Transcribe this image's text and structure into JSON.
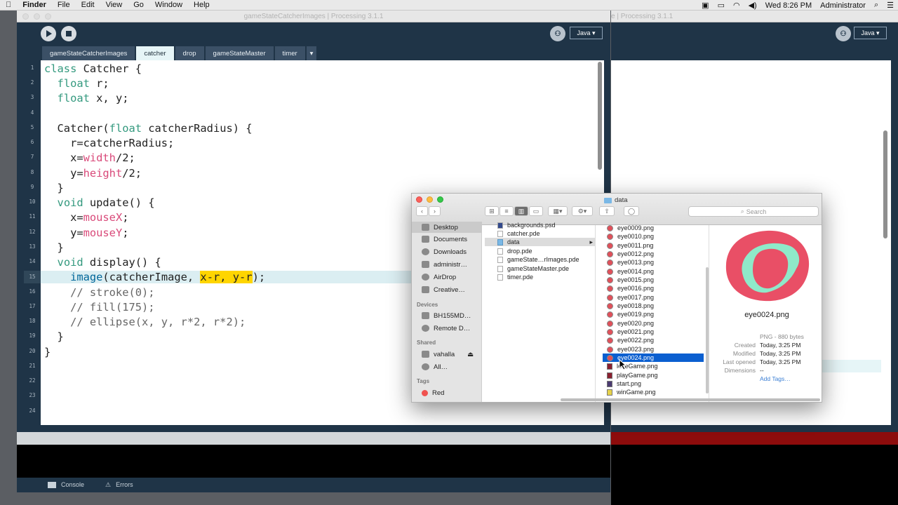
{
  "menubar": {
    "app": "Finder",
    "menus": [
      "File",
      "Edit",
      "View",
      "Go",
      "Window",
      "Help"
    ],
    "clock": "Wed 8:26 PM",
    "user": "Administrator"
  },
  "left_window": {
    "title": "gameStateCatcherImages | Processing 3.1.1",
    "mode": "Java ▾",
    "tabs": [
      "gameStateCatcherImages",
      "catcher",
      "drop",
      "gameStateMaster",
      "timer",
      "▾"
    ],
    "active_tab": "catcher",
    "footer": {
      "console": "Console",
      "errors": "Errors"
    },
    "line_numbers": [
      "1",
      "2",
      "3",
      "4",
      "5",
      "6",
      "7",
      "8",
      "9",
      "10",
      "11",
      "12",
      "13",
      "14",
      "15",
      "16",
      "17",
      "18",
      "19",
      "20",
      "21",
      "22",
      "23",
      "24"
    ]
  },
  "code": {
    "l1": [
      "class",
      " Catcher {"
    ],
    "l2": [
      "  ",
      "float",
      " r;"
    ],
    "l3": [
      "  ",
      "float",
      " x, y;"
    ],
    "l5": [
      "  Catcher(",
      "float",
      " catcherRadius) {"
    ],
    "l6": "    r=catcherRadius;",
    "l7": [
      "    x=",
      "width",
      "/2;"
    ],
    "l8": [
      "    y=",
      "height",
      "/2;"
    ],
    "l9": "  }",
    "l10": [
      "  ",
      "void",
      " update() {"
    ],
    "l11": [
      "    x=",
      "mouseX",
      ";"
    ],
    "l12": [
      "    y=",
      "mouseY",
      ";"
    ],
    "l13": "  }",
    "l14": [
      "  ",
      "void",
      " display() {"
    ],
    "l15": [
      "    ",
      "image",
      "(catcherImage, ",
      "x-r, y-r",
      ");"
    ],
    "l16": "    // stroke(0);",
    "l17": "    // fill(175);",
    "l18": "    // ellipse(x, y, r*2, r*2);",
    "l19": "  }",
    "l20": "}"
  },
  "right_window": {
    "title": "e | Processing 3.1.1",
    "mode": "Java ▾"
  },
  "finder": {
    "title": "data",
    "search_placeholder": "Search",
    "sidebar": {
      "favorites": [
        "Desktop",
        "Documents",
        "Downloads",
        "administr…",
        "AirDrop",
        "Creative…"
      ],
      "devices_header": "Devices",
      "devices": [
        "BH155MD…",
        "Remote D…"
      ],
      "shared_header": "Shared",
      "shared": [
        "vahalla",
        "All…"
      ],
      "tags_header": "Tags",
      "tags": [
        "Red"
      ]
    },
    "column1": [
      "backgrounds.psd",
      "catcher.pde",
      "data",
      "drop.pde",
      "gameState…rImages.pde",
      "gameStateMaster.pde",
      "timer.pde"
    ],
    "column2": [
      "eye0009.png",
      "eye0010.png",
      "eye0011.png",
      "eye0012.png",
      "eye0013.png",
      "eye0014.png",
      "eye0015.png",
      "eye0016.png",
      "eye0017.png",
      "eye0018.png",
      "eye0019.png",
      "eye0020.png",
      "eye0021.png",
      "eye0022.png",
      "eye0023.png",
      "eye0024.png",
      "loseGame.png",
      "playGame.png",
      "start.png",
      "winGame.png"
    ],
    "selected_file": "eye0024.png",
    "preview": {
      "name": "eye0024.png",
      "kind_size": "PNG - 880 bytes",
      "created_label": "Created",
      "created": "Today, 3:25 PM",
      "modified_label": "Modified",
      "modified": "Today, 3:25 PM",
      "opened_label": "Last opened",
      "opened": "Today, 3:25 PM",
      "dimensions_label": "Dimensions",
      "dimensions": "--",
      "add_tags": "Add Tags…"
    }
  }
}
